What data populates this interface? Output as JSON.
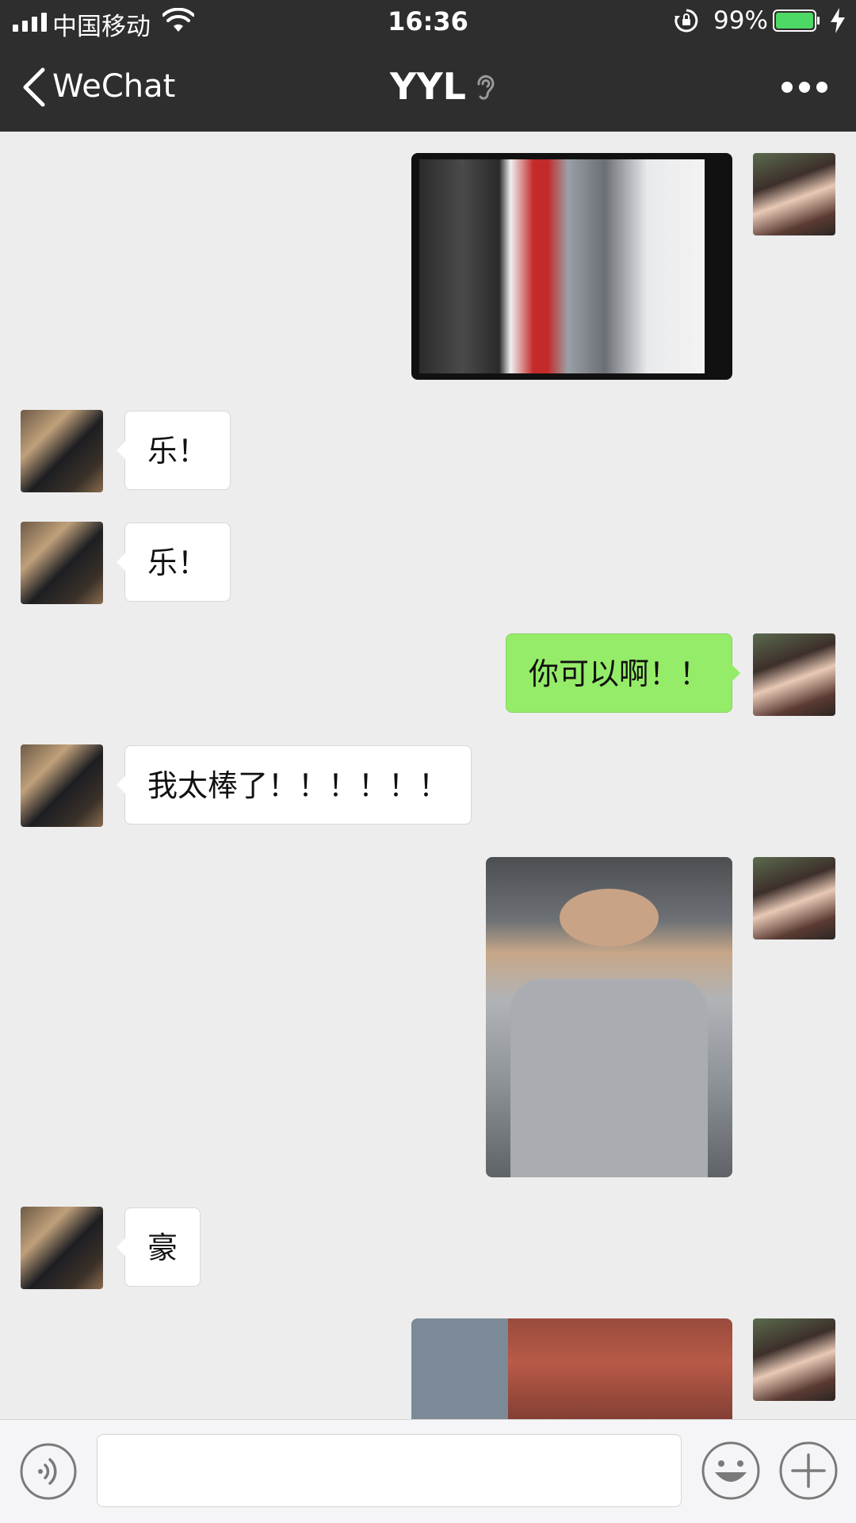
{
  "status_bar": {
    "carrier": "中国移动",
    "time": "16:36",
    "battery_percent": "99%"
  },
  "nav": {
    "back_label": "WeChat",
    "title": "YYL"
  },
  "messages": [
    {
      "side": "right",
      "type": "image",
      "icon": "photo-boxing"
    },
    {
      "side": "left",
      "type": "text",
      "text": "乐！"
    },
    {
      "side": "left",
      "type": "text",
      "text": "乐！"
    },
    {
      "side": "right",
      "type": "text",
      "text": "你可以啊！！"
    },
    {
      "side": "left",
      "type": "text",
      "text": "我太棒了！！！！！！"
    },
    {
      "side": "right",
      "type": "image",
      "icon": "photo-portrait"
    },
    {
      "side": "left",
      "type": "text",
      "text": "豪"
    },
    {
      "side": "right",
      "type": "image",
      "icon": "photo-building"
    }
  ],
  "input": {
    "value": "",
    "placeholder": ""
  },
  "colors": {
    "bar_bg": "#2e2e2e",
    "chat_bg": "#ededed",
    "bubble_green": "#95ec69",
    "bubble_white": "#ffffff",
    "battery_green": "#4cd964"
  }
}
